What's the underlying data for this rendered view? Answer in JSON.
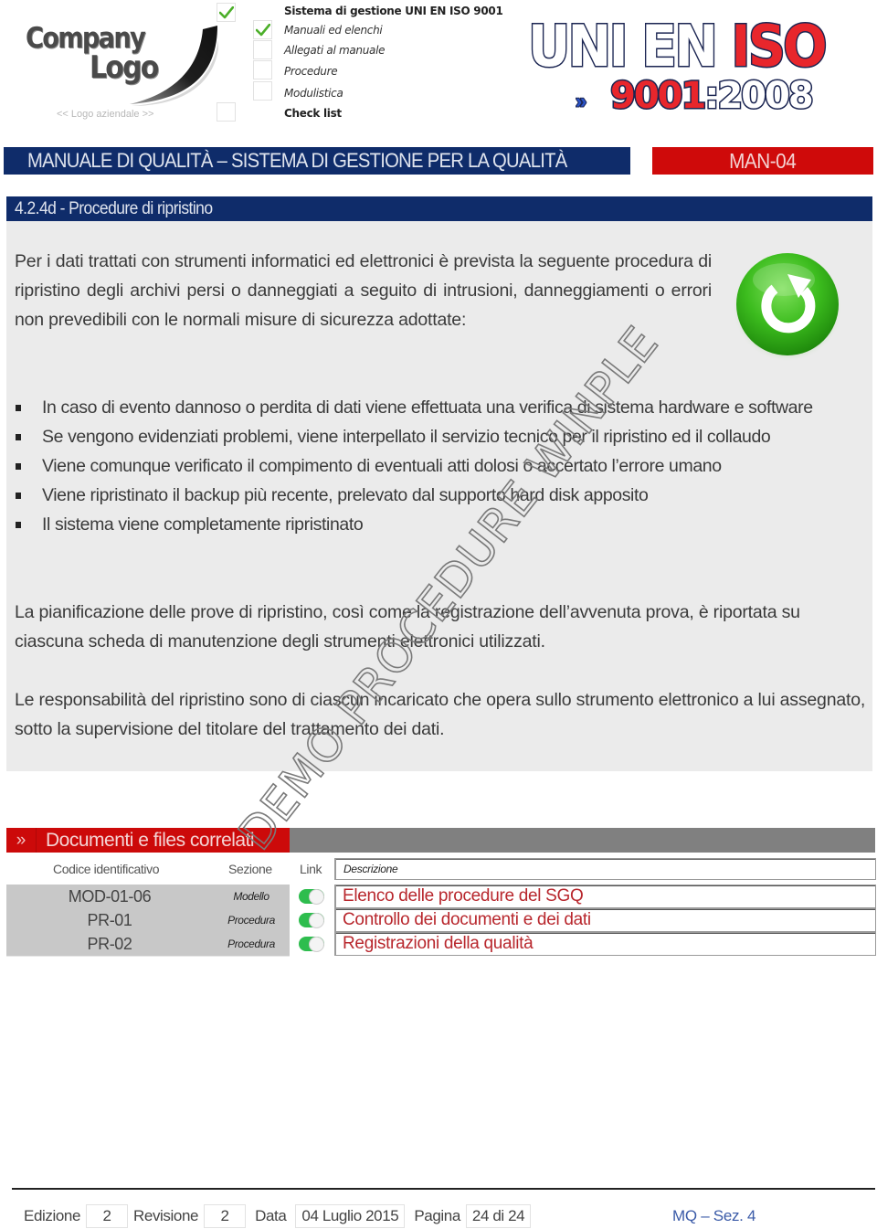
{
  "header": {
    "logo": {
      "line1": "Company",
      "line2": "Logo",
      "caption": "<< Logo aziendale >>"
    },
    "checklist": [
      {
        "label": "Sistema di gestione UNI EN ISO 9001",
        "style": "bold",
        "checked": true
      },
      {
        "label": "Manuali ed elenchi",
        "style": "italic",
        "checked": true
      },
      {
        "label": "Allegati al manuale",
        "style": "italic",
        "checked": false
      },
      {
        "label": "Procedure",
        "style": "italic",
        "checked": false
      },
      {
        "label": "Modulistica",
        "style": "italic",
        "checked": false
      },
      {
        "label": "Check list",
        "style": "bold",
        "checked": false
      }
    ],
    "iso_badge": {
      "word1": "UNI EN",
      "word2": "ISO",
      "num_red": "9001",
      "num_white": ":2008",
      "chevron": "»"
    }
  },
  "title_bar": {
    "title": "MANUALE DI QUALITÀ – SISTEMA DI GESTIONE PER LA QUALITÀ",
    "code": "MAN-04"
  },
  "section": {
    "heading": "4.2.4d - Procedure di ripristino",
    "intro": "Per i dati trattati con strumenti informatici ed elettronici è prevista la seguente procedura di ripristino degli archivi persi o danneggiati a seguito di intrusioni, danneggiamenti o errori non prevedibili con le normali misure di sicurezza adottate:",
    "icon": "restore-icon",
    "bullets": [
      "In caso di evento dannoso o perdita di dati viene effettuata una verifica di sistema hardware e software",
      "Se vengono evidenziati problemi, viene interpellato il servizio tecnico per il ripristino ed il collaudo",
      "Viene comunque verificato il compimento di eventuali atti dolosi o accertato l’errore umano",
      "Viene ripristinato il backup più recente, prelevato dal supporto hard disk apposito",
      "Il sistema viene completamente ripristinato"
    ],
    "paragraph2": "La pianificazione delle prove di ripristino, così come la registrazione dell’avvenuta prova, è riportata su ciascuna scheda di manutenzione degli strumenti elettronici utilizzati.",
    "paragraph3": "Le responsabilità del ripristino sono di ciascun incaricato che opera sullo strumento elettronico a lui assegnato, sotto la supervisione del titolare del trattamento dei dati.",
    "watermark": "DEMO PROCEDURE WINPLE"
  },
  "related_docs": {
    "chevron": "»",
    "heading": "Documenti e files correlati",
    "columns": {
      "code": "Codice identificativo",
      "section": "Sezione",
      "link": "Link",
      "description": "Descrizione"
    },
    "rows": [
      {
        "code": "MOD-01-06",
        "section": "Modello",
        "link_on": true,
        "description": "Elenco delle procedure del  SGQ"
      },
      {
        "code": "PR-01",
        "section": "Procedura",
        "link_on": true,
        "description": "Controllo dei documenti e dei dati"
      },
      {
        "code": "PR-02",
        "section": "Procedura",
        "link_on": true,
        "description": "Registrazioni della qualità"
      }
    ]
  },
  "footer": {
    "edition_label": "Edizione",
    "edition": "2",
    "revision_label": "Revisione",
    "revision": "2",
    "date_label": "Data",
    "date": "04 Luglio 2015",
    "page_label": "Pagina",
    "page": "24 di 24",
    "section_ref": "MQ – Sez. 4"
  },
  "colors": {
    "navy": "#0f2c6a",
    "red": "#cc0a0a",
    "panel_grey": "#ebebeb",
    "link_red": "#b8272d",
    "toggle_green": "#2ebd4e",
    "footer_blue": "#3b5ba8"
  }
}
